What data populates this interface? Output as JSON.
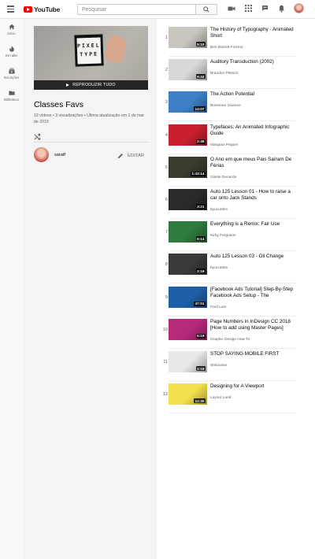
{
  "header": {
    "logo_text": "YouTube",
    "search_placeholder": "Pesquisar",
    "icons": [
      "menu-icon",
      "search-icon",
      "video-camera-icon",
      "apps-grid-icon",
      "chat-icon",
      "bell-icon"
    ]
  },
  "nav": {
    "items": [
      {
        "label": "Início",
        "icon": "home-icon"
      },
      {
        "label": "Em alta",
        "icon": "flame-icon"
      },
      {
        "label": "Inscrições",
        "icon": "subscriptions-icon"
      },
      {
        "label": "Biblioteca",
        "icon": "folder-icon"
      }
    ]
  },
  "playlist": {
    "thumb_text_line1": "PIXEL",
    "thumb_text_line2": "TYPE",
    "play_all_label": "REPRODUZIR TUDO",
    "title": "Classes Favs",
    "stats": "12 vídeos • 3 visualizações • Última atualização em 1 de mai de 2019",
    "owner_name": "saratf",
    "edit_label": "EDITAR"
  },
  "videos": [
    {
      "index": "1",
      "title": "The History of Typography - Animated Short",
      "channel": "Ben Barrett-Forrest",
      "duration": "5:10",
      "thumb_color": "#c9c6c0"
    },
    {
      "index": "2",
      "title": "Auditory Transduction (2002)",
      "channel": "Brandon Pletsch",
      "duration": "6:44",
      "thumb_color": "#d8d8d8"
    },
    {
      "index": "3",
      "title": "The Action Potential",
      "channel": "Bozeman Science",
      "duration": "14:07",
      "thumb_color": "#3d7fc6"
    },
    {
      "index": "4",
      "title": "Typefaces: An Animated Infographic Guide",
      "channel": "Margaux Pepper",
      "duration": "2:46",
      "thumb_color": "#c8202e"
    },
    {
      "index": "5",
      "title": "O Ano em que meus Pais Saíram De Férias",
      "channel": "Gisele Denarde",
      "duration": "1:43:14",
      "thumb_color": "#3a3a2e"
    },
    {
      "index": "6",
      "title": "Auto 125 Lesson 01 - How to raise a car onto Jack Stands",
      "channel": "byucurdev",
      "duration": "3:21",
      "thumb_color": "#2a2a2a"
    },
    {
      "index": "7",
      "title": "Everything is a Remix: Fair Use",
      "channel": "Kirby Ferguson",
      "duration": "6:14",
      "thumb_color": "#2f7a3e"
    },
    {
      "index": "8",
      "title": "Auto 125 Lesson 03 - Oil Change",
      "channel": "byucurdev",
      "duration": "2:16",
      "thumb_color": "#3a3a3a"
    },
    {
      "index": "9",
      "title": "[Facebook Ads Tutorial] Step-By-Step Facebook Ads Setup - The",
      "channel": "Fred Lam",
      "duration": "47:01",
      "thumb_color": "#1f5fa8"
    },
    {
      "index": "10",
      "title": "Page Numbers in InDesign CC 2018 [How to add using Master Pages]",
      "channel": "Graphic Design How To",
      "duration": "5:19",
      "thumb_color": "#b62a7a"
    },
    {
      "index": "11",
      "title": "STOP SAYING MOBILE FIRST",
      "channel": "Webonise",
      "duration": "2:18",
      "thumb_color": "#e9e9e9"
    },
    {
      "index": "12",
      "title": "Designing for A Viewport",
      "channel": "Layout Land",
      "duration": "12:30",
      "thumb_color": "#f2e14c"
    }
  ]
}
